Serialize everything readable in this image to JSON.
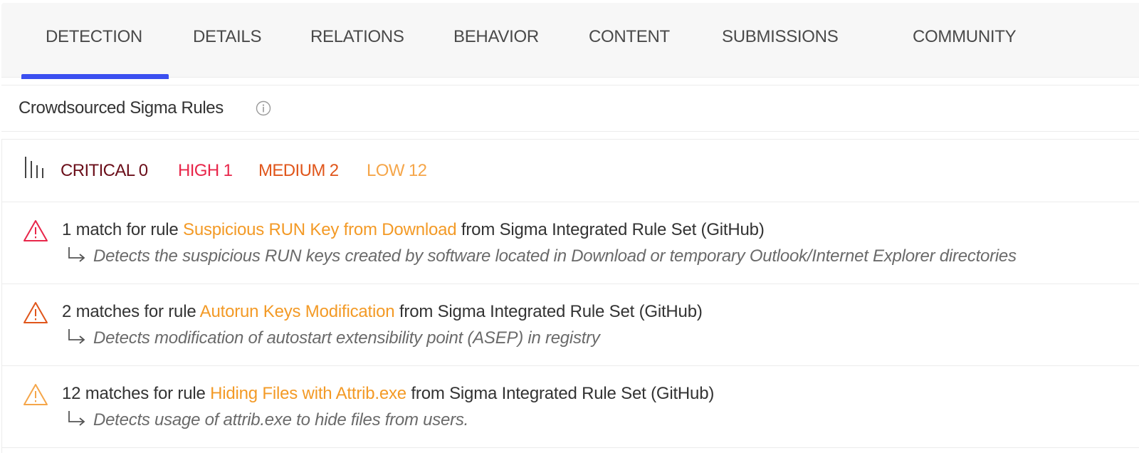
{
  "tabs": [
    {
      "label": "DETECTION",
      "active": true
    },
    {
      "label": "DETAILS"
    },
    {
      "label": "RELATIONS"
    },
    {
      "label": "BEHAVIOR"
    },
    {
      "label": "CONTENT"
    },
    {
      "label": "SUBMISSIONS"
    },
    {
      "label": "COMMUNITY"
    }
  ],
  "section": {
    "title": "Crowdsourced Sigma Rules",
    "info_icon": "info-circle-icon"
  },
  "summary": {
    "icon": "severity-bars-icon",
    "critical": {
      "label": "CRITICAL 0",
      "color": "#6b0f1a"
    },
    "high": {
      "label": "HIGH 1",
      "color": "#e8264a"
    },
    "medium": {
      "label": "MEDIUM 2",
      "color": "#e0561b"
    },
    "low": {
      "label": "LOW 12",
      "color": "#f5a64a"
    }
  },
  "rules": [
    {
      "prefix": "1 match for rule ",
      "rule_name": "Suspicious RUN Key from Download",
      "suffix": " from Sigma Integrated Rule Set (GitHub)",
      "description": "Detects the suspicious RUN keys created by software located in Download or temporary Outlook/Internet Explorer directories",
      "severity": "high",
      "icon_color": "#e8264a"
    },
    {
      "prefix": "2 matches for rule ",
      "rule_name": "Autorun Keys Modification",
      "suffix": " from Sigma Integrated Rule Set (GitHub)",
      "description": "Detects modification of autostart extensibility point (ASEP) in registry",
      "severity": "medium",
      "icon_color": "#e0561b"
    },
    {
      "prefix": "12 matches for rule ",
      "rule_name": "Hiding Files with Attrib.exe",
      "suffix": " from Sigma Integrated Rule Set (GitHub)",
      "description": "Detects usage of attrib.exe to hide files from users.",
      "severity": "low",
      "icon_color": "#f5a64a"
    }
  ],
  "colors": {
    "accent": "#3b4ff0",
    "rule_link": "#f39a26"
  }
}
